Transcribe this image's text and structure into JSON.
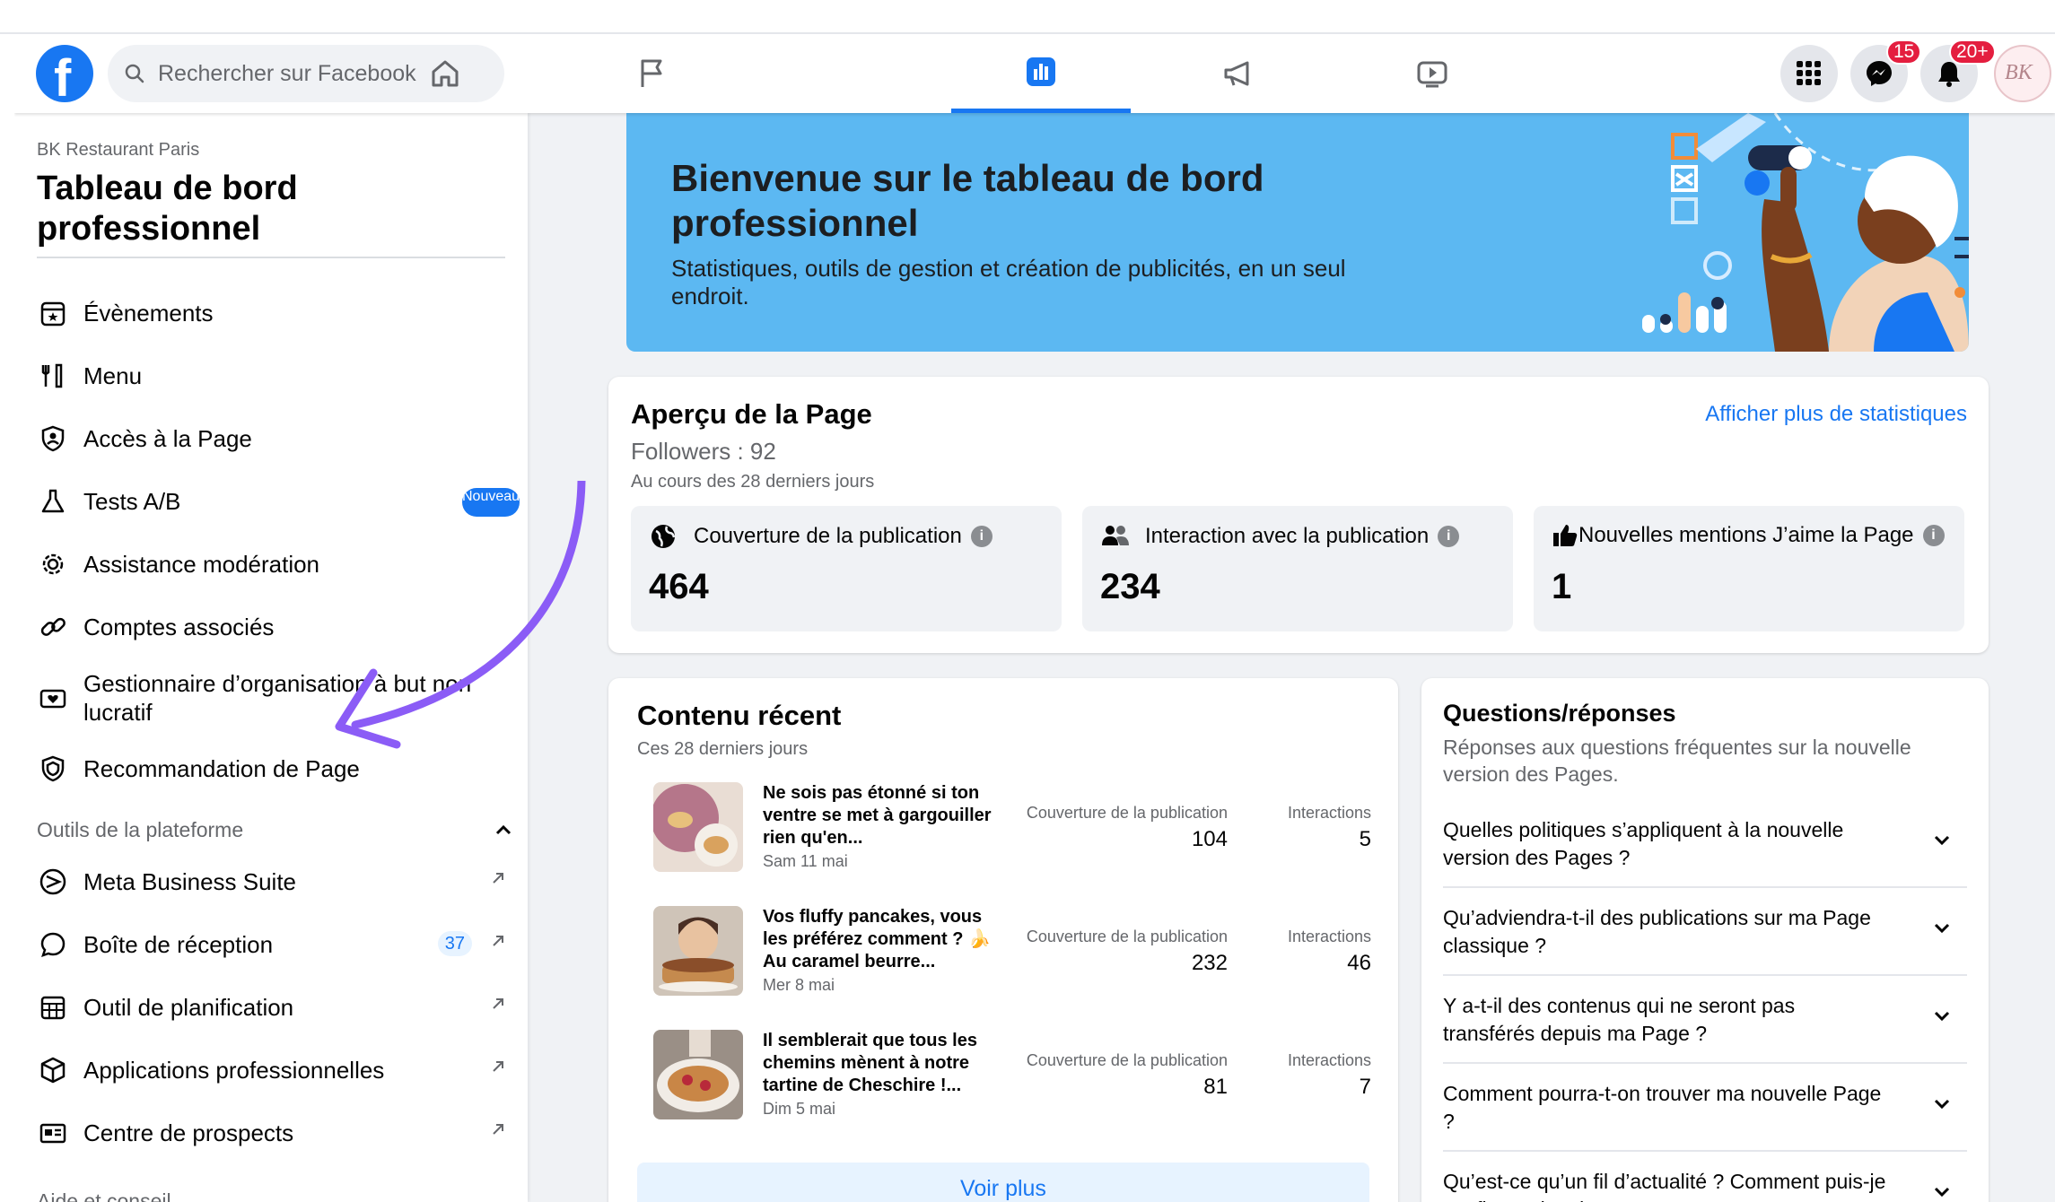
{
  "search": {
    "placeholder": "Rechercher sur Facebook"
  },
  "header": {
    "messenger_badge": "15",
    "notifications_badge": "20+",
    "avatar_text": "BK"
  },
  "sidebar": {
    "page_name": "BK Restaurant Paris",
    "title": "Tableau de bord professionnel",
    "items": [
      {
        "label": "Évènements",
        "icon": "calendar-star-icon"
      },
      {
        "label": "Menu",
        "icon": "utensils-icon"
      },
      {
        "label": "Accès à la Page",
        "icon": "shield-person-icon"
      },
      {
        "label": "Tests A/B",
        "icon": "flask-icon",
        "badge": "Nouveau"
      },
      {
        "label": "Assistance modération",
        "icon": "gear-shield-icon"
      },
      {
        "label": "Comptes associés",
        "icon": "link-icon"
      },
      {
        "label": "Gestionnaire d’organisation à but non lucratif",
        "icon": "heart-box-icon"
      },
      {
        "label": "Recommandation de Page",
        "icon": "badge-shield-icon"
      }
    ],
    "section_title": "Outils de la plateforme",
    "tools": [
      {
        "label": "Meta Business Suite",
        "icon": "meta-suite-icon"
      },
      {
        "label": "Boîte de réception",
        "icon": "chat-bubble-icon",
        "badge": "37"
      },
      {
        "label": "Outil de planification",
        "icon": "grid-calendar-icon"
      },
      {
        "label": "Applications professionnelles",
        "icon": "cube-icon"
      },
      {
        "label": "Centre de prospects",
        "icon": "id-card-icon"
      }
    ],
    "bottom_section": "Aide et conseil"
  },
  "banner": {
    "title": "Bienvenue sur le tableau de bord professionnel",
    "text": "Statistiques, outils de gestion et création de publicités, en un seul endroit."
  },
  "overview": {
    "title": "Aperçu de la Page",
    "link": "Afficher plus de statistiques",
    "followers": "Followers : 92",
    "period": "Au cours des 28 derniers jours",
    "metrics": [
      {
        "label": "Couverture de la publication",
        "value": "464",
        "icon": "globe-icon"
      },
      {
        "label": "Interaction avec la publication",
        "value": "234",
        "icon": "people-icon"
      },
      {
        "label": "Nouvelles mentions J’aime la Page",
        "value": "1",
        "icon": "thumbs-up-icon"
      }
    ]
  },
  "recent": {
    "title": "Contenu récent",
    "subtitle": "Ces 28 derniers jours",
    "col_reach": "Couverture de la publication",
    "col_interactions": "Interactions",
    "posts": [
      {
        "text": "Ne sois pas étonné si ton ventre se met à gargouiller rien qu'en...",
        "date": "Sam 11 mai",
        "reach": "104",
        "interactions": "5"
      },
      {
        "text": "Vos fluffy pancakes, vous les préférez comment ? 🍌 Au caramel beurre...",
        "date": "Mer 8 mai",
        "reach": "232",
        "interactions": "46"
      },
      {
        "text": "Il semblerait que tous les chemins mènent à notre tartine de Cheschire !...",
        "date": "Dim 5 mai",
        "reach": "81",
        "interactions": "7"
      }
    ],
    "see_more": "Voir plus"
  },
  "qa": {
    "title": "Questions/réponses",
    "subtitle": "Réponses aux questions fréquentes sur la nouvelle version des Pages.",
    "items": [
      "Quelles politiques s’appliquent à la nouvelle version des Pages ?",
      "Qu’adviendra-t-il des publications sur ma Page classique ?",
      "Y a-t-il des contenus qui ne seront pas transférés depuis ma Page ?",
      "Comment pourra-t-on trouver ma nouvelle Page ?",
      "Qu’est-ce qu’un fil d’actualité ? Comment puis-je configurer le mien ?"
    ]
  },
  "colors": {
    "accent": "#1877f2",
    "banner": "#5cb8f2",
    "arrow": "#8b5cf6",
    "badge": "#e41e3f"
  }
}
